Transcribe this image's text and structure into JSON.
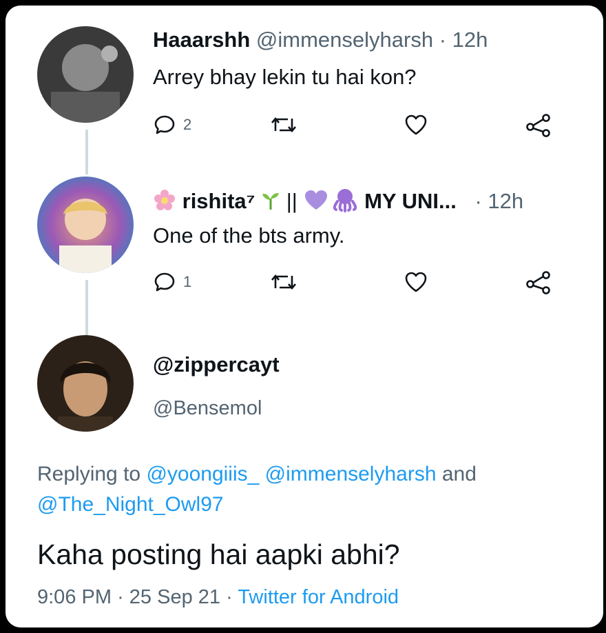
{
  "tweets": [
    {
      "display_name": "Haaarshh",
      "handle": "@immenselyharsh",
      "separator": "·",
      "time": "12h",
      "text": "Arrey bhay lekin tu hai kon?",
      "reply_count": "2",
      "avatar_icon": "avatar-photo"
    },
    {
      "display_name": "rishita⁷",
      "name_suffix": "||",
      "name_tail": "MY UNI...",
      "separator": "·",
      "time": "12h",
      "text": "One of the bts army.",
      "reply_count": "1",
      "avatar_icon": "avatar-photo"
    }
  ],
  "main_tweet": {
    "display_name": "@zippercayt",
    "handle": "@Bensemol",
    "replying_prefix": "Replying to",
    "replying_mentions": [
      "@yoongiiis_",
      "@immenselyharsh"
    ],
    "replying_and": "and",
    "replying_last": "@The_Night_Owl97",
    "text": "Kaha posting hai aapki abhi?",
    "time": "9:06 PM",
    "date": "25 Sep 21",
    "separator": "·",
    "source": "Twitter for Android"
  },
  "colors": {
    "link": "#1d9bf0",
    "muted": "#536471",
    "text": "#0f1419",
    "thread_line": "#cfd9de"
  }
}
